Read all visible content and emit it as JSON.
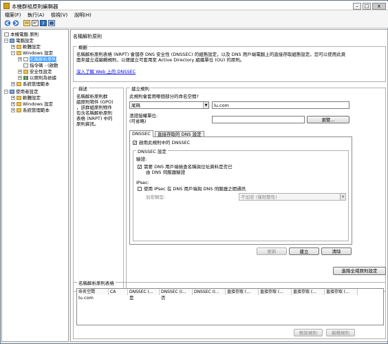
{
  "window": {
    "title": "本機群組原則編輯器",
    "min": "–",
    "max": "□",
    "close": "x"
  },
  "menu": [
    "檔案(F)",
    "執行(A)",
    "檢視(V)",
    "說明(H)"
  ],
  "tree": {
    "root": "本機電腦 原則",
    "computer": "電腦設定",
    "c_software": "軟體設定",
    "c_windows": "Windows 設定",
    "c_nrpt": "名稱解析原則",
    "c_scripts": "指令碼 - (啟動",
    "c_security": "安全性設定",
    "c_qos": "以原則為依據",
    "c_admin": "系統管理範本",
    "user": "使用者設定",
    "u_software": "軟體設定",
    "u_windows": "Windows 設定",
    "u_admin": "系統管理範本"
  },
  "main": {
    "title": "名稱解析原則",
    "overview_legend": "概觀",
    "overview_line1": "名稱解析原則表格 (NRPT) 會儲存 DNS 安全性 (DNSSEC) 的組態設定，以及 DNS 用戶端電腦上的直接存取組態設定。您可以使用此頁",
    "overview_line2": "面來建立或編輯規則，以便建立可套用至 Active Directory 組織單位 (OU) 的原則。",
    "learn_link": "深入了解 Web 上的 DNSSEC",
    "desc_legend": "描述",
    "desc_text": [
      "名稱解析原則群",
      "組原則物件 (GPO)",
      "，該群組原則物件",
      "包含名稱解析原則",
      "表格 (NRPT) 中的",
      "原則資訊。"
    ],
    "rule_legend": "建立規則",
    "ns_question": "此規則會套用哪個部分的命名空間?",
    "ns_type": "尾碼",
    "ns_value": "lu.com",
    "cert_label": "憑證授權單位:",
    "cert_optional": "(可省略)",
    "browse": "瀏覽...",
    "tab_dnssec": "DNSSEC",
    "tab_direct": "直接存取的 DNS 設定",
    "enable_dnssec": "啟用此規則中的 DNSSEC",
    "dnssec_settings": "DNSSEC 設定",
    "validation_label": "驗證:",
    "require_validation_1": "需要 DNS 用戶端檢查名稱與位址資料是否已",
    "require_validation_2": "由 DNS 伺服器驗證",
    "ipsec_label": "IPsec:",
    "use_ipsec": "使用 IPsec 在 DNS 用戶端與 DNS 伺服器之間通訊",
    "encryption_label": "加密類型:",
    "encryption_value": "不加密 (僅限整性)",
    "btn_update": "更新",
    "btn_create": "建立",
    "btn_clear": "清除",
    "btn_advanced": "進階全域原則設定",
    "table_legend": "名稱解析原則表格",
    "columns": [
      "命名空間",
      "CA",
      "DNSSEC (...",
      "DNSSEC (I...",
      "DNSSEC (I...",
      "直接存取 (...",
      "直接存取 (...",
      "直接存取 (...",
      "直接存取 (..."
    ],
    "row": [
      "lu.com",
      "",
      "是",
      "否",
      "",
      "",
      "",
      "",
      ""
    ],
    "btn_delete": "刪除規則",
    "btn_edit": "編輯規則"
  }
}
